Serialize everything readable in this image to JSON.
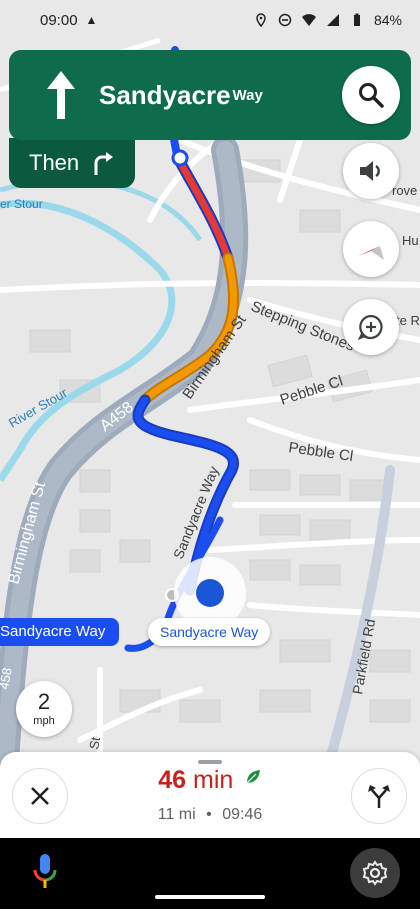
{
  "status_bar": {
    "time": "09:00",
    "battery": "84%"
  },
  "guidance": {
    "street": "Sandyacre",
    "street_suffix": "Way",
    "then_label": "Then"
  },
  "map_labels": {
    "stepping_stones": "Stepping Stones",
    "birmingham_st_top": "Birmingham St",
    "river_stour_top": "er Stour",
    "river_stour": "River Stour",
    "a458": "A458",
    "birmingham_st_left": "Birmingham St",
    "pebble_cl_1": "Pebble Cl",
    "pebble_cl_2": "Pebble Cl",
    "sandyacre_way": "Sandyacre Way",
    "parkfield_rd": "Parkfield Rd",
    "edge_rove": "rove",
    "edge_hu": "Hu",
    "edge_te_r": "te R",
    "edge_st": "St",
    "edge_458": "458"
  },
  "route_label": "Sandyacre Way",
  "destination_label": "Sandyacre Way",
  "speed": {
    "value": "2",
    "unit": "mph"
  },
  "trip": {
    "eta_value": "46",
    "eta_unit": "min",
    "distance": "11 mi",
    "separator": "•",
    "arrival": "09:46"
  },
  "colors": {
    "guidance_bg": "#0e6b4c",
    "route_blue": "#1a4ef0",
    "traffic_red": "#e53935",
    "traffic_orange": "#f29900",
    "eta_red": "#c5221f"
  }
}
